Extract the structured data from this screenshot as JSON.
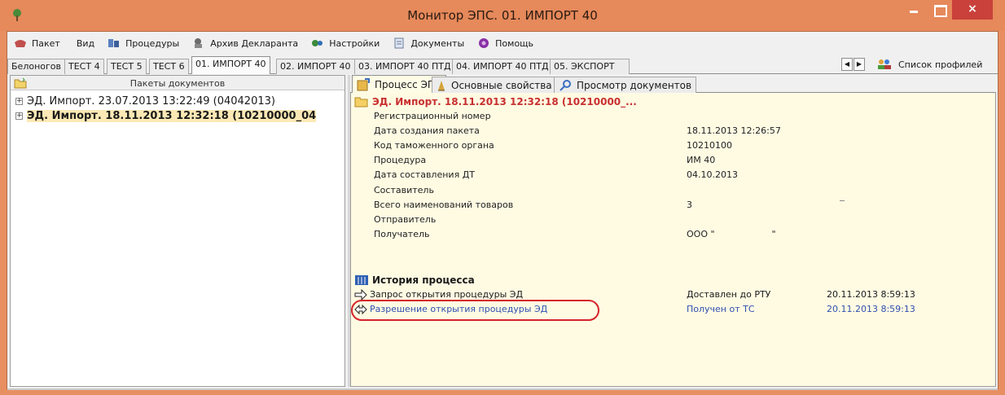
{
  "window": {
    "title": "Монитор ЭПС. 01. ИМПОРТ 40",
    "accent": "#e6895b",
    "close_glyph": "×"
  },
  "menu": [
    {
      "icon": "package-icon",
      "label": "Пакет"
    },
    {
      "icon": "",
      "label": "Вид"
    },
    {
      "icon": "procedures-icon",
      "label": "Процедуры"
    },
    {
      "icon": "archive-icon",
      "label": "Архив Декларанта"
    },
    {
      "icon": "settings-icon",
      "label": "Настройки"
    },
    {
      "icon": "documents-icon",
      "label": "Документы"
    },
    {
      "icon": "help-icon",
      "label": "Помощь"
    }
  ],
  "profile_tabs": [
    "Белоногов",
    "ТЕСТ 4",
    "ТЕСТ 5",
    "ТЕСТ 6",
    "01. ИМПОРТ 40",
    "02. ИМПОРТ 40",
    "03. ИМПОРТ 40 ПТД",
    "04. ИМПОРТ 40 ПТД",
    "05. ЭКСПОРТ"
  ],
  "active_profile_tab": "01. ИМПОРТ 40",
  "tab_scroll": {
    "left": "◀",
    "right": "▶"
  },
  "profiles_list_label": "Список профилей",
  "left_panel": {
    "title": "Пакеты документов",
    "packages": [
      {
        "expander": "+",
        "label": "ЭД. Импорт. 23.07.2013 13:22:49 (04042013)",
        "selected": false
      },
      {
        "expander": "+",
        "label": "ЭД. Импорт. 18.11.2013 12:32:18 (10210000_04",
        "selected": true
      }
    ]
  },
  "right_tabs": [
    {
      "icon": "process-icon",
      "label": "Процесс ЭПС"
    },
    {
      "icon": "properties-icon",
      "label": "Основные свойства"
    },
    {
      "icon": "preview-icon",
      "label": "Просмотр документов"
    }
  ],
  "package_details": {
    "title": "ЭД. Импорт. 18.11.2013 12:32:18 (10210000_...",
    "properties": [
      {
        "label": "Регистрационный номер",
        "value": ""
      },
      {
        "label": "Дата создания пакета",
        "value": "18.11.2013 12:26:57"
      },
      {
        "label": "Код таможенного органа",
        "value": "10210100"
      },
      {
        "label": "Процедура",
        "value": "ИМ 40"
      },
      {
        "label": "Дата составления ДТ",
        "value": "04.10.2013"
      },
      {
        "label": "Составитель",
        "value": ""
      },
      {
        "label": "Всего наименований товаров",
        "value": "3"
      },
      {
        "label": "Отправитель",
        "value": ""
      },
      {
        "label": "Получатель",
        "value": "ООО \"                    \""
      }
    ]
  },
  "history": {
    "title": "История процесса",
    "items": [
      {
        "icon": "arrow-right-icon",
        "name": "Запрос открытия процедуры ЭД",
        "status": "Доставлен до РТУ",
        "time": "20.11.2013 8:59:13"
      },
      {
        "icon": "arrow-both-icon",
        "name": "Разрешение открытия процедуры ЭД",
        "status": "Получен от ТС",
        "time": "20.11.2013 8:59:13"
      }
    ]
  }
}
